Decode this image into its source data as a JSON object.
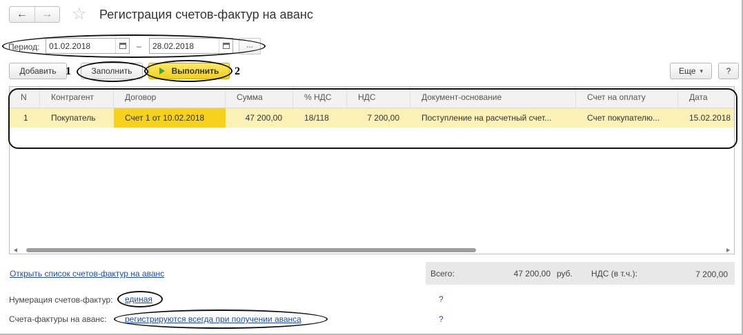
{
  "window": {
    "title": "Регистрация счетов-фактур на аванс",
    "nav_back_icon": "←",
    "nav_forward_icon": "→",
    "star_icon": "☆"
  },
  "period": {
    "label": "Период:",
    "date_from": "01.02.2018",
    "separator": "–",
    "date_to": "28.02.2018",
    "more_label": "..."
  },
  "toolbar": {
    "add_label": "Добавить",
    "fill_label": "Заполнить",
    "run_label": "Выполнить",
    "more_label": "Еще",
    "more_caret": "▾",
    "help_label": "?",
    "mark_1": "1",
    "mark_2": "2"
  },
  "table": {
    "columns": [
      "N",
      "Контрагент",
      "Договор",
      "Сумма",
      "% НДС",
      "НДС",
      "Документ-основание",
      "Счет на оплату",
      "Дата"
    ],
    "rows": [
      [
        "1",
        "Покупатель",
        "Счет 1 от 10.02.2018",
        "47 200,00",
        "18/118",
        "7 200,00",
        "Поступление на расчетный счет...",
        "Счет покупателю...",
        "15.02.2018"
      ]
    ]
  },
  "footer": {
    "open_list_link": "Открыть список счетов-фактур на аванс",
    "total_label": "Всего:",
    "total_value": "47 200,00",
    "currency": "руб.",
    "vat_label": "НДС (в т.ч.):",
    "vat_value": "7 200,00",
    "numbering_label": "Нумерация счетов-фактур:",
    "numbering_value": "единая",
    "invoices_label": "Счета-фактуры на аванс:",
    "invoices_value": "регистрируются всегда при получении аванса",
    "help_1": "?",
    "help_2": "?"
  },
  "colors": {
    "accent_yellow": "#f6d21f",
    "row_highlight": "#fbf1b6",
    "link": "#1d4b9c",
    "play_green": "#39a83a"
  }
}
